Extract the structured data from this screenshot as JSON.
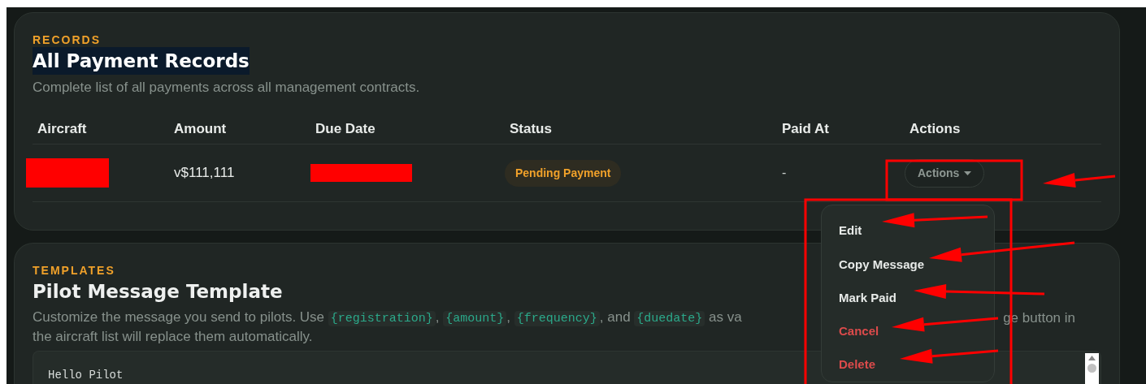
{
  "records": {
    "eyebrow": "RECORDS",
    "title": "All Payment Records",
    "title_highlighted": true,
    "description": "Complete list of all payments across all management contracts.",
    "table": {
      "columns": [
        "Aircraft",
        "Amount",
        "Due Date",
        "Status",
        "Paid At",
        "Actions"
      ],
      "rows": [
        {
          "amount": "v$111,111",
          "status": "Pending Payment",
          "paid_at": "-",
          "actions_button": "Actions"
        }
      ]
    }
  },
  "actions_menu": {
    "items": [
      {
        "label": "Edit",
        "kind": "normal"
      },
      {
        "label": "Copy Message",
        "kind": "normal"
      },
      {
        "label": "Mark Paid",
        "kind": "normal"
      },
      {
        "label": "Cancel",
        "kind": "danger"
      },
      {
        "label": "Delete",
        "kind": "danger"
      }
    ]
  },
  "templates": {
    "eyebrow": "TEMPLATES",
    "title": "Pilot Message Template",
    "description": [
      {
        "kind": "text",
        "text": "Customize the message you send to pilots. Use "
      },
      {
        "kind": "code",
        "text": "{registration}"
      },
      {
        "kind": "text",
        "text": ", "
      },
      {
        "kind": "code",
        "text": "{amount}"
      },
      {
        "kind": "text",
        "text": ", "
      },
      {
        "kind": "code",
        "text": "{frequency}"
      },
      {
        "kind": "text",
        "text": ", and "
      },
      {
        "kind": "code",
        "text": "{duedate}"
      },
      {
        "kind": "text",
        "text": " as va"
      }
    ],
    "description_continued": "ge button in",
    "description_line_2": "the aircraft list will replace them automatically.",
    "editor_text": "Hello Pilot"
  }
}
